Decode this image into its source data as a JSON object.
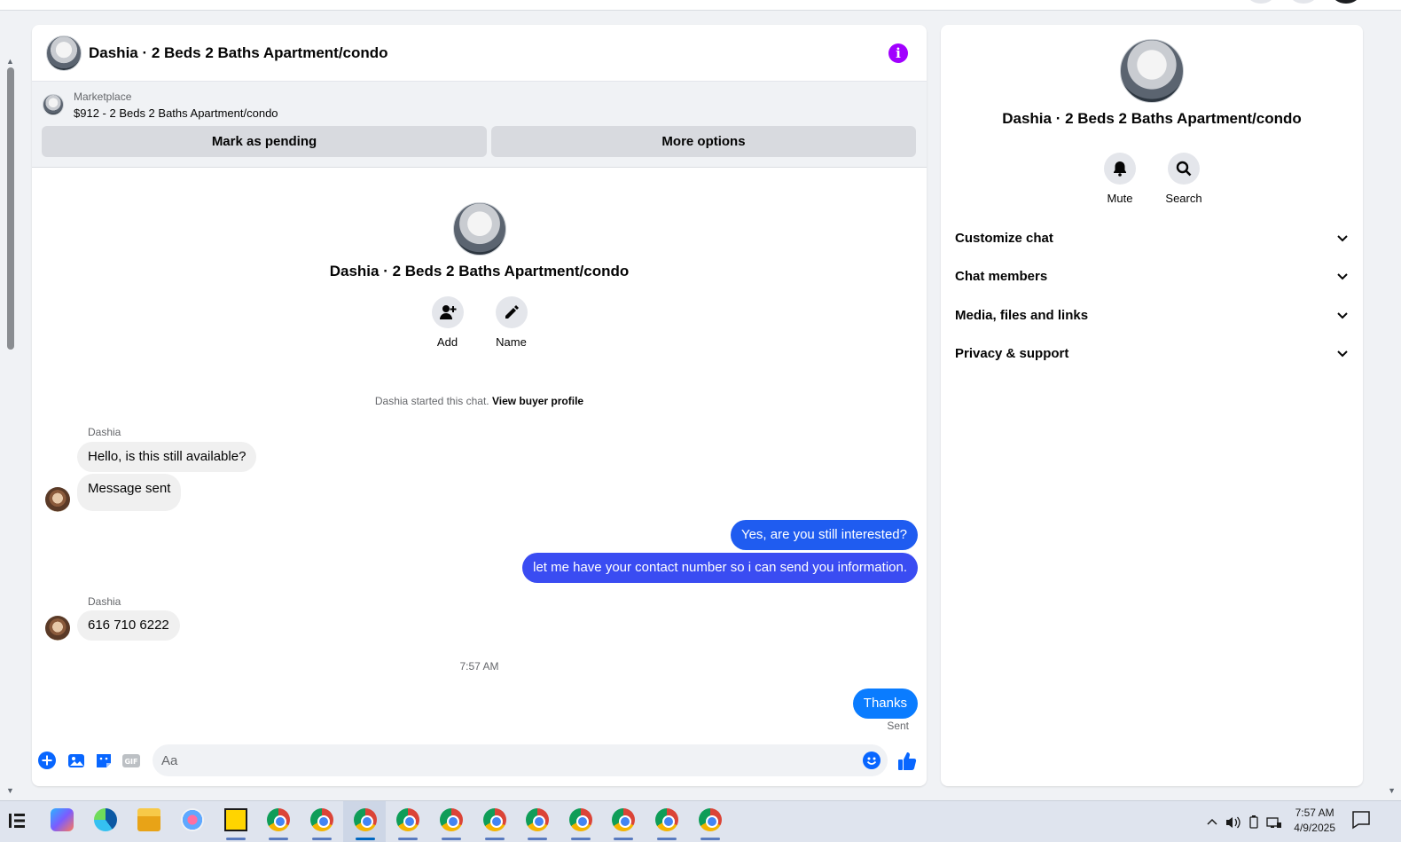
{
  "header": {
    "title": "Dashia · 2 Beds 2 Baths Apartment/condo"
  },
  "marketplace": {
    "label": "Marketplace",
    "listing": "$912 - 2 Beds 2 Baths Apartment/condo",
    "pending_button": "Mark as pending",
    "more_button": "More options"
  },
  "intro": {
    "title": "Dashia · 2 Beds 2 Baths Apartment/condo",
    "actions": [
      {
        "label": "Add",
        "icon": "add-person-icon"
      },
      {
        "label": "Name",
        "icon": "pencil-icon"
      }
    ],
    "started_text": "Dashia started this chat.",
    "buyer_profile_link": "View buyer profile"
  },
  "messages": [
    {
      "sender": "Dashia",
      "text": "Hello, is this still available?",
      "direction": "in"
    },
    {
      "text": "Message sent",
      "direction": "in"
    },
    {
      "text": "Yes, are you still interested?",
      "direction": "out"
    },
    {
      "text": "let me have your contact number so i can send you information.",
      "direction": "out"
    },
    {
      "sender": "Dashia",
      "text": "616 710 6222",
      "direction": "in"
    },
    {
      "text": "Thanks",
      "direction": "out"
    }
  ],
  "timestamp": "7:57 AM",
  "sent_status": "Sent",
  "composer": {
    "placeholder": "Aa"
  },
  "info_panel": {
    "title": "Dashia · 2 Beds 2 Baths Apartment/condo",
    "actions": [
      {
        "label": "Mute",
        "icon": "bell-icon"
      },
      {
        "label": "Search",
        "icon": "search-icon"
      }
    ],
    "sections": [
      "Customize chat",
      "Chat members",
      "Media, files and links",
      "Privacy & support"
    ]
  },
  "taskbar": {
    "time": "7:57 AM",
    "date": "4/9/2025"
  },
  "colors": {
    "accent": "#0866ff",
    "info_purple": "#a100ff",
    "outgoing_bubble": "#1f5cf0"
  }
}
